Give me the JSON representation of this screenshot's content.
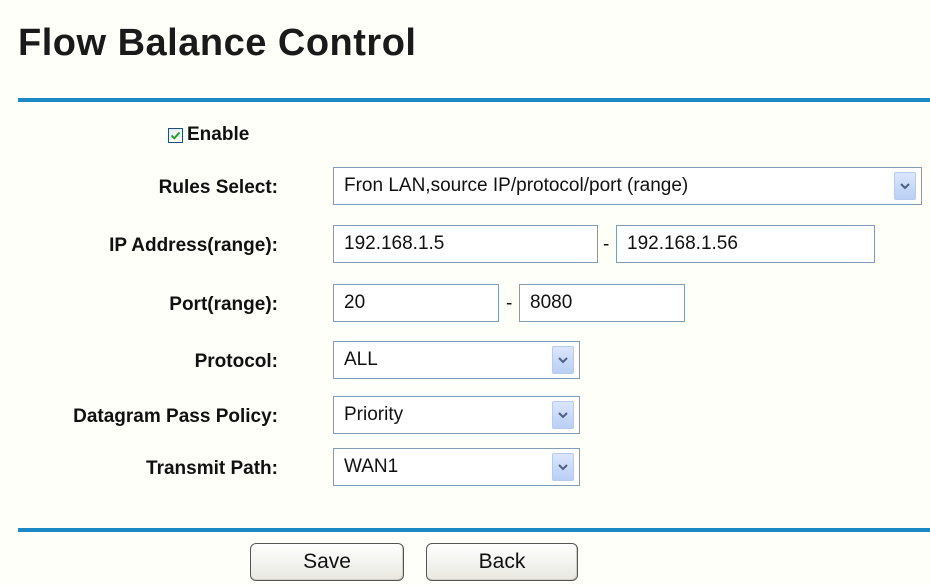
{
  "page": {
    "title": "Flow Balance Control"
  },
  "form": {
    "enable": {
      "label": "Enable",
      "checked": true
    },
    "rules_select": {
      "label": "Rules Select:",
      "value": "Fron LAN,source IP/protocol/port (range)"
    },
    "ip_address": {
      "label": "IP Address(range):",
      "start": "192.168.1.5",
      "separator": "-",
      "end": "192.168.1.56"
    },
    "port": {
      "label": "Port(range):",
      "start": "20",
      "separator": "-",
      "end": "8080"
    },
    "protocol": {
      "label": "Protocol:",
      "value": "ALL"
    },
    "datagram_pass_policy": {
      "label": "Datagram Pass Policy:",
      "value": "Priority"
    },
    "transmit_path": {
      "label": "Transmit Path:",
      "value": "WAN1"
    }
  },
  "buttons": {
    "save": "Save",
    "back": "Back"
  },
  "colors": {
    "divider": "#1b8ac4",
    "background": "#fefff8",
    "input_border": "#7f9db9"
  }
}
